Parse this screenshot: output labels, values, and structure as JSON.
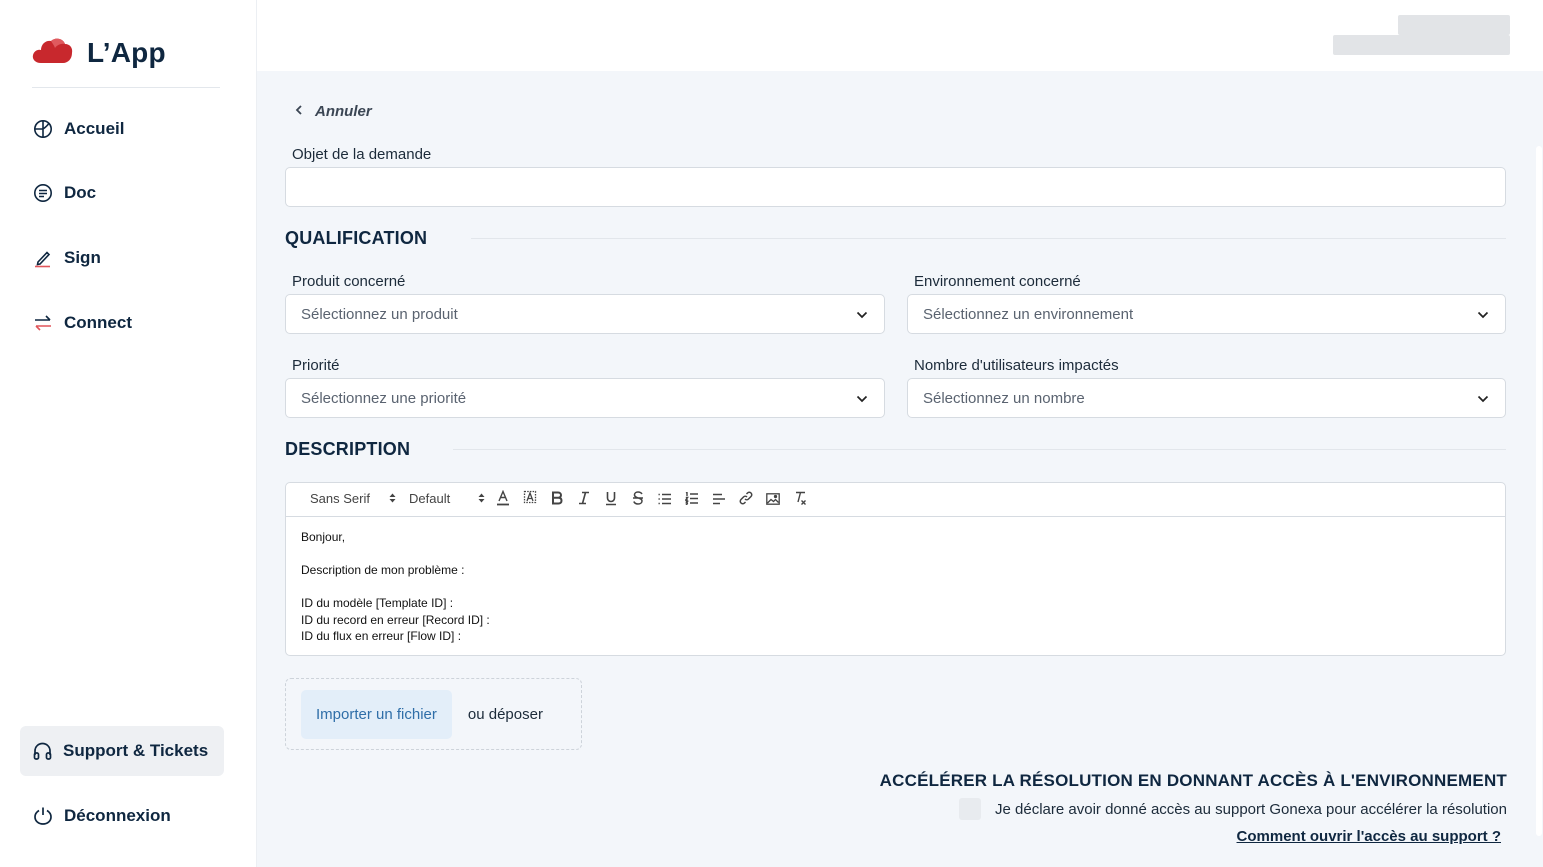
{
  "app": {
    "name": "L’App",
    "brand_color": "#c8282d"
  },
  "sidebar": {
    "items": [
      {
        "label": "Accueil",
        "icon": "globe-icon"
      },
      {
        "label": "Doc",
        "icon": "document-icon"
      },
      {
        "label": "Sign",
        "icon": "pen-icon"
      },
      {
        "label": "Connect",
        "icon": "arrows-exchange-icon"
      }
    ],
    "support": {
      "label": "Support & Tickets",
      "icon": "headphones-icon"
    },
    "logout": {
      "label": "Déconnexion",
      "icon": "power-icon"
    }
  },
  "form": {
    "back_label": "Annuler",
    "subject_label": "Objet de la demande",
    "subject_value": "",
    "qualification_title": "QUALIFICATION",
    "product": {
      "label": "Produit concerné",
      "placeholder": "Sélectionnez un produit"
    },
    "environment": {
      "label": "Environnement concerné",
      "placeholder": "Sélectionnez un environnement"
    },
    "priority": {
      "label": "Priorité",
      "placeholder": "Sélectionnez une priorité"
    },
    "users": {
      "label": "Nombre d'utilisateurs impactés",
      "placeholder": "Sélectionnez un nombre"
    },
    "description_title": "DESCRIPTION",
    "editor": {
      "font": "Sans Serif",
      "size": "Default",
      "lines": [
        "Bonjour,",
        "",
        "Description de mon problème :",
        "",
        "ID du modèle [Template ID] :",
        "ID du record en erreur [Record ID] :",
        "ID du flux en erreur [Flow ID] :"
      ]
    },
    "upload": {
      "button": "Importer un fichier",
      "or_text": "ou déposer"
    },
    "access": {
      "title": "ACCÉLÉRER LA RÉSOLUTION EN DONNANT ACCÈS À L'ENVIRONNEMENT",
      "checkbox_label": "Je déclare avoir donné accès au support Gonexa pour accélérer la résolution",
      "checked": false,
      "link": "Comment ouvrir l'accès au support ?"
    }
  }
}
